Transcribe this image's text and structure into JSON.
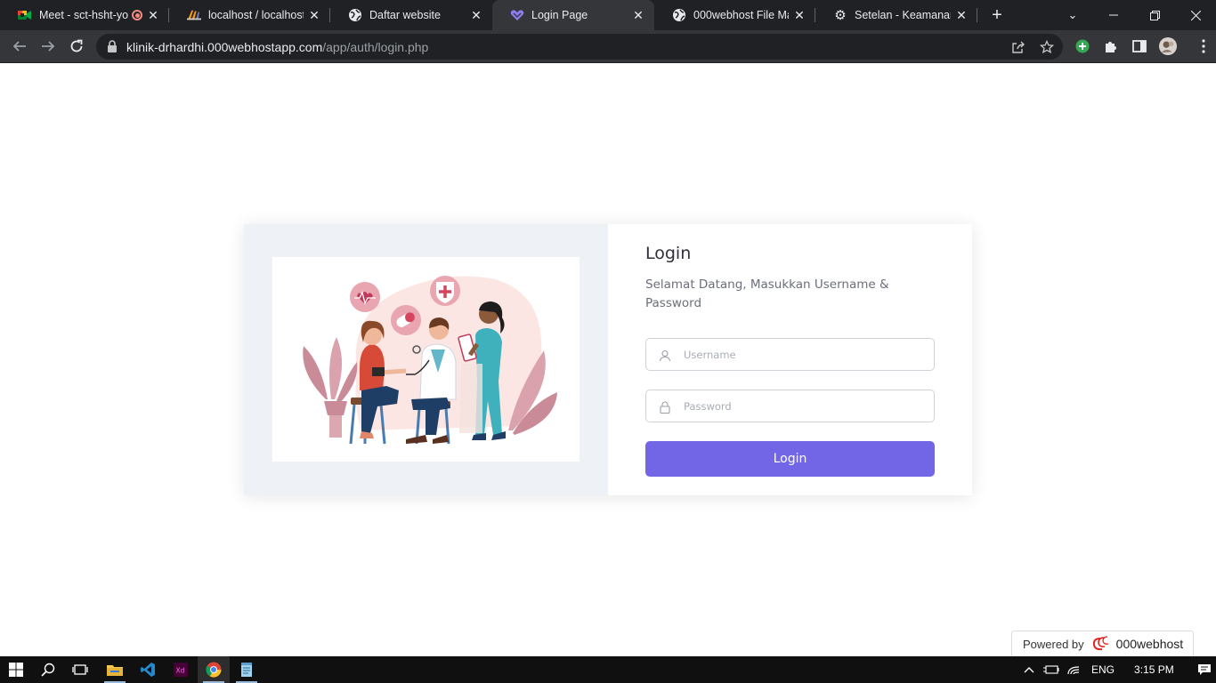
{
  "browser": {
    "tabs": [
      {
        "title": "Meet - sct-hsht-yoo",
        "icon": "google-meet-icon",
        "recording": true,
        "active": false
      },
      {
        "title": "localhost / localhost / ",
        "icon": "phpmyadmin-icon",
        "active": false
      },
      {
        "title": "Daftar website",
        "icon": "globe-icon",
        "active": false
      },
      {
        "title": "Login Page",
        "icon": "heart-logo-icon",
        "active": true
      },
      {
        "title": "000webhost File Mana",
        "icon": "globe-icon",
        "active": false
      },
      {
        "title": "Setelan - Keamanan",
        "icon": "gear-icon",
        "active": false
      }
    ],
    "url_host": "klinik-drhardhi.000webhostapp.com",
    "url_path": "/app/auth/login.php"
  },
  "login": {
    "title": "Login",
    "subtitle": "Selamat Datang, Masukkan Username & Password",
    "username_placeholder": "Username",
    "password_placeholder": "Password",
    "button_label": "Login",
    "accent_color": "#7266e6"
  },
  "footer": {
    "powered_label": "Powered by",
    "brand": "000webhost"
  },
  "taskbar": {
    "language": "ENG",
    "time": "3:15 PM"
  }
}
